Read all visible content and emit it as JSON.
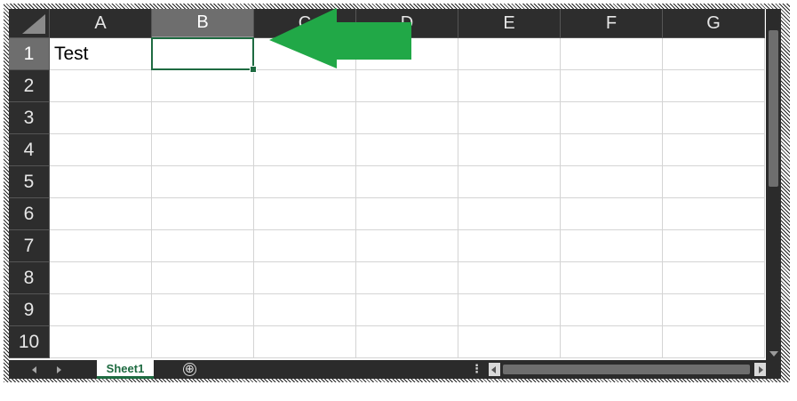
{
  "grid": {
    "columns": [
      "A",
      "B",
      "C",
      "D",
      "E",
      "F",
      "G"
    ],
    "selected_column": "B",
    "rows": [
      "1",
      "2",
      "3",
      "4",
      "5",
      "6",
      "7",
      "8",
      "9",
      "10"
    ],
    "selected_row": "1",
    "cells": {
      "A1": "Test"
    },
    "active_cell": "B1"
  },
  "sheet_tabs": {
    "active": "Sheet1",
    "add_symbol": "⊕"
  },
  "annotation": {
    "arrow_color": "#21a847",
    "pointing_to": "B1"
  },
  "colors": {
    "header_bg": "#2d2d2d",
    "header_selected_bg": "#6e6e6e",
    "accent": "#1e6b41"
  }
}
